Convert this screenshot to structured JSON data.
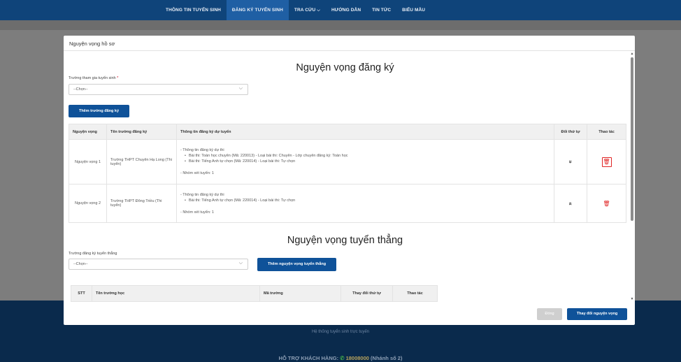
{
  "nav": {
    "items": [
      {
        "label": "THÔNG TIN TUYỂN SINH",
        "active": false
      },
      {
        "label": "ĐĂNG KÝ TUYỂN SINH",
        "active": true
      },
      {
        "label": "TRA CỨU",
        "active": false,
        "has_dropdown": true
      },
      {
        "label": "HƯỚNG DẪN",
        "active": false
      },
      {
        "label": "TIN TỨC",
        "active": false
      },
      {
        "label": "BIỂU MẪU",
        "active": false
      }
    ],
    "dropdown_glyph": "⌵"
  },
  "background": {
    "footer_subtitle": "Hệ thống tuyển sinh trực tuyến",
    "hotline_label": "HỖ TRỢ KHÁCH HÀNG:",
    "hotline_number": "18008000",
    "hotline_ext": "(Nhánh số 2)"
  },
  "modal": {
    "header_title": "Nguyện vọng hồ sơ",
    "section1": {
      "title": "Nguyện vọng đăng ký",
      "school_label": "Trường tham gia tuyển sinh",
      "required_mark": "*",
      "school_select_value": "--Chọn--",
      "add_button": "Thêm trường đăng ký",
      "table": {
        "headers": [
          "Nguyện vọng",
          "Tên trường đăng ký",
          "Thông tin đăng ký dự tuyển",
          "Đổi thứ tự",
          "Thao tác"
        ],
        "rows": [
          {
            "nv": "Nguyện vọng 1",
            "school": "Trường THPT Chuyên Hạ Long (Thi tuyển)",
            "info_title": "- Thông tin đăng ký dự thi",
            "info_items": [
              "Bài thi: Toán học chuyên (Mã: 220013) - Loại bài thi: Chuyên - Lớp chuyên đăng ký: Toán học",
              "Bài thi: Tiếng Anh tự chọn (Mã: 220014) - Loại bài thi: Tự chọn"
            ],
            "info_group": "- Nhóm xét tuyển: 1",
            "order_icon": "down-icon",
            "order_glyph": "»",
            "delete_icon": "trash-icon",
            "delete_highlighted": true
          },
          {
            "nv": "Nguyện vọng 2",
            "school": "Trường THPT Đông Triều (Thi tuyển)",
            "info_title": "- Thông tin đăng ký dự thi",
            "info_items": [
              "Bài thi: Tiếng Anh tự chọn (Mã: 220014) - Loại bài thi: Tự chọn"
            ],
            "info_group": "- Nhóm xét tuyển: 1",
            "order_icon": "up-icon",
            "order_glyph": "«",
            "delete_icon": "trash-icon",
            "delete_highlighted": false
          }
        ]
      }
    },
    "section2": {
      "title": "Nguyện vọng tuyển thẳng",
      "school_label": "Trường đăng ký tuyển thẳng",
      "school_select_value": "--Chọn--",
      "add_button": "Thêm nguyện vọng tuyển thẳng",
      "table": {
        "headers": [
          "STT",
          "Tên trường học",
          "Mã trường",
          "Thay đổi thứ tự",
          "Thao tác"
        ]
      }
    },
    "footer": {
      "close_button": "Đóng",
      "change_button": "Thay đổi nguyện vọng"
    }
  },
  "colors": {
    "nav_bg": "#0f447a",
    "nav_active": "#1f5fa4",
    "primary_button": "#0f5299",
    "danger": "#e02424",
    "overlay": "#7d7d7d"
  }
}
